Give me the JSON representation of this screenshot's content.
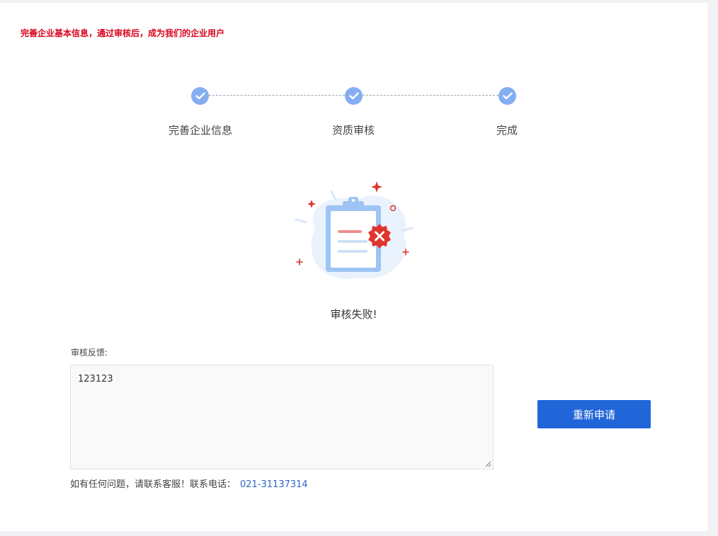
{
  "notice": "完善企业基本信息，通过审核后，成为我们的企业用户",
  "steps": [
    {
      "label": "完善企业信息",
      "status": "done"
    },
    {
      "label": "资质审核",
      "status": "done"
    },
    {
      "label": "完成",
      "status": "done"
    }
  ],
  "result": {
    "title": "审核失败!",
    "icon": "clipboard-rejected-icon"
  },
  "feedback": {
    "label": "审核反馈:",
    "value": "123123"
  },
  "reapply_label": "重新申请",
  "contact": {
    "text": "如有任何问题，请联系客服！联系电话：",
    "phone": "021-31137314"
  },
  "colors": {
    "accent": "#2166d8",
    "step_done": "#85adf2",
    "error": "#d9001b",
    "reject_badge": "#e0342f"
  }
}
